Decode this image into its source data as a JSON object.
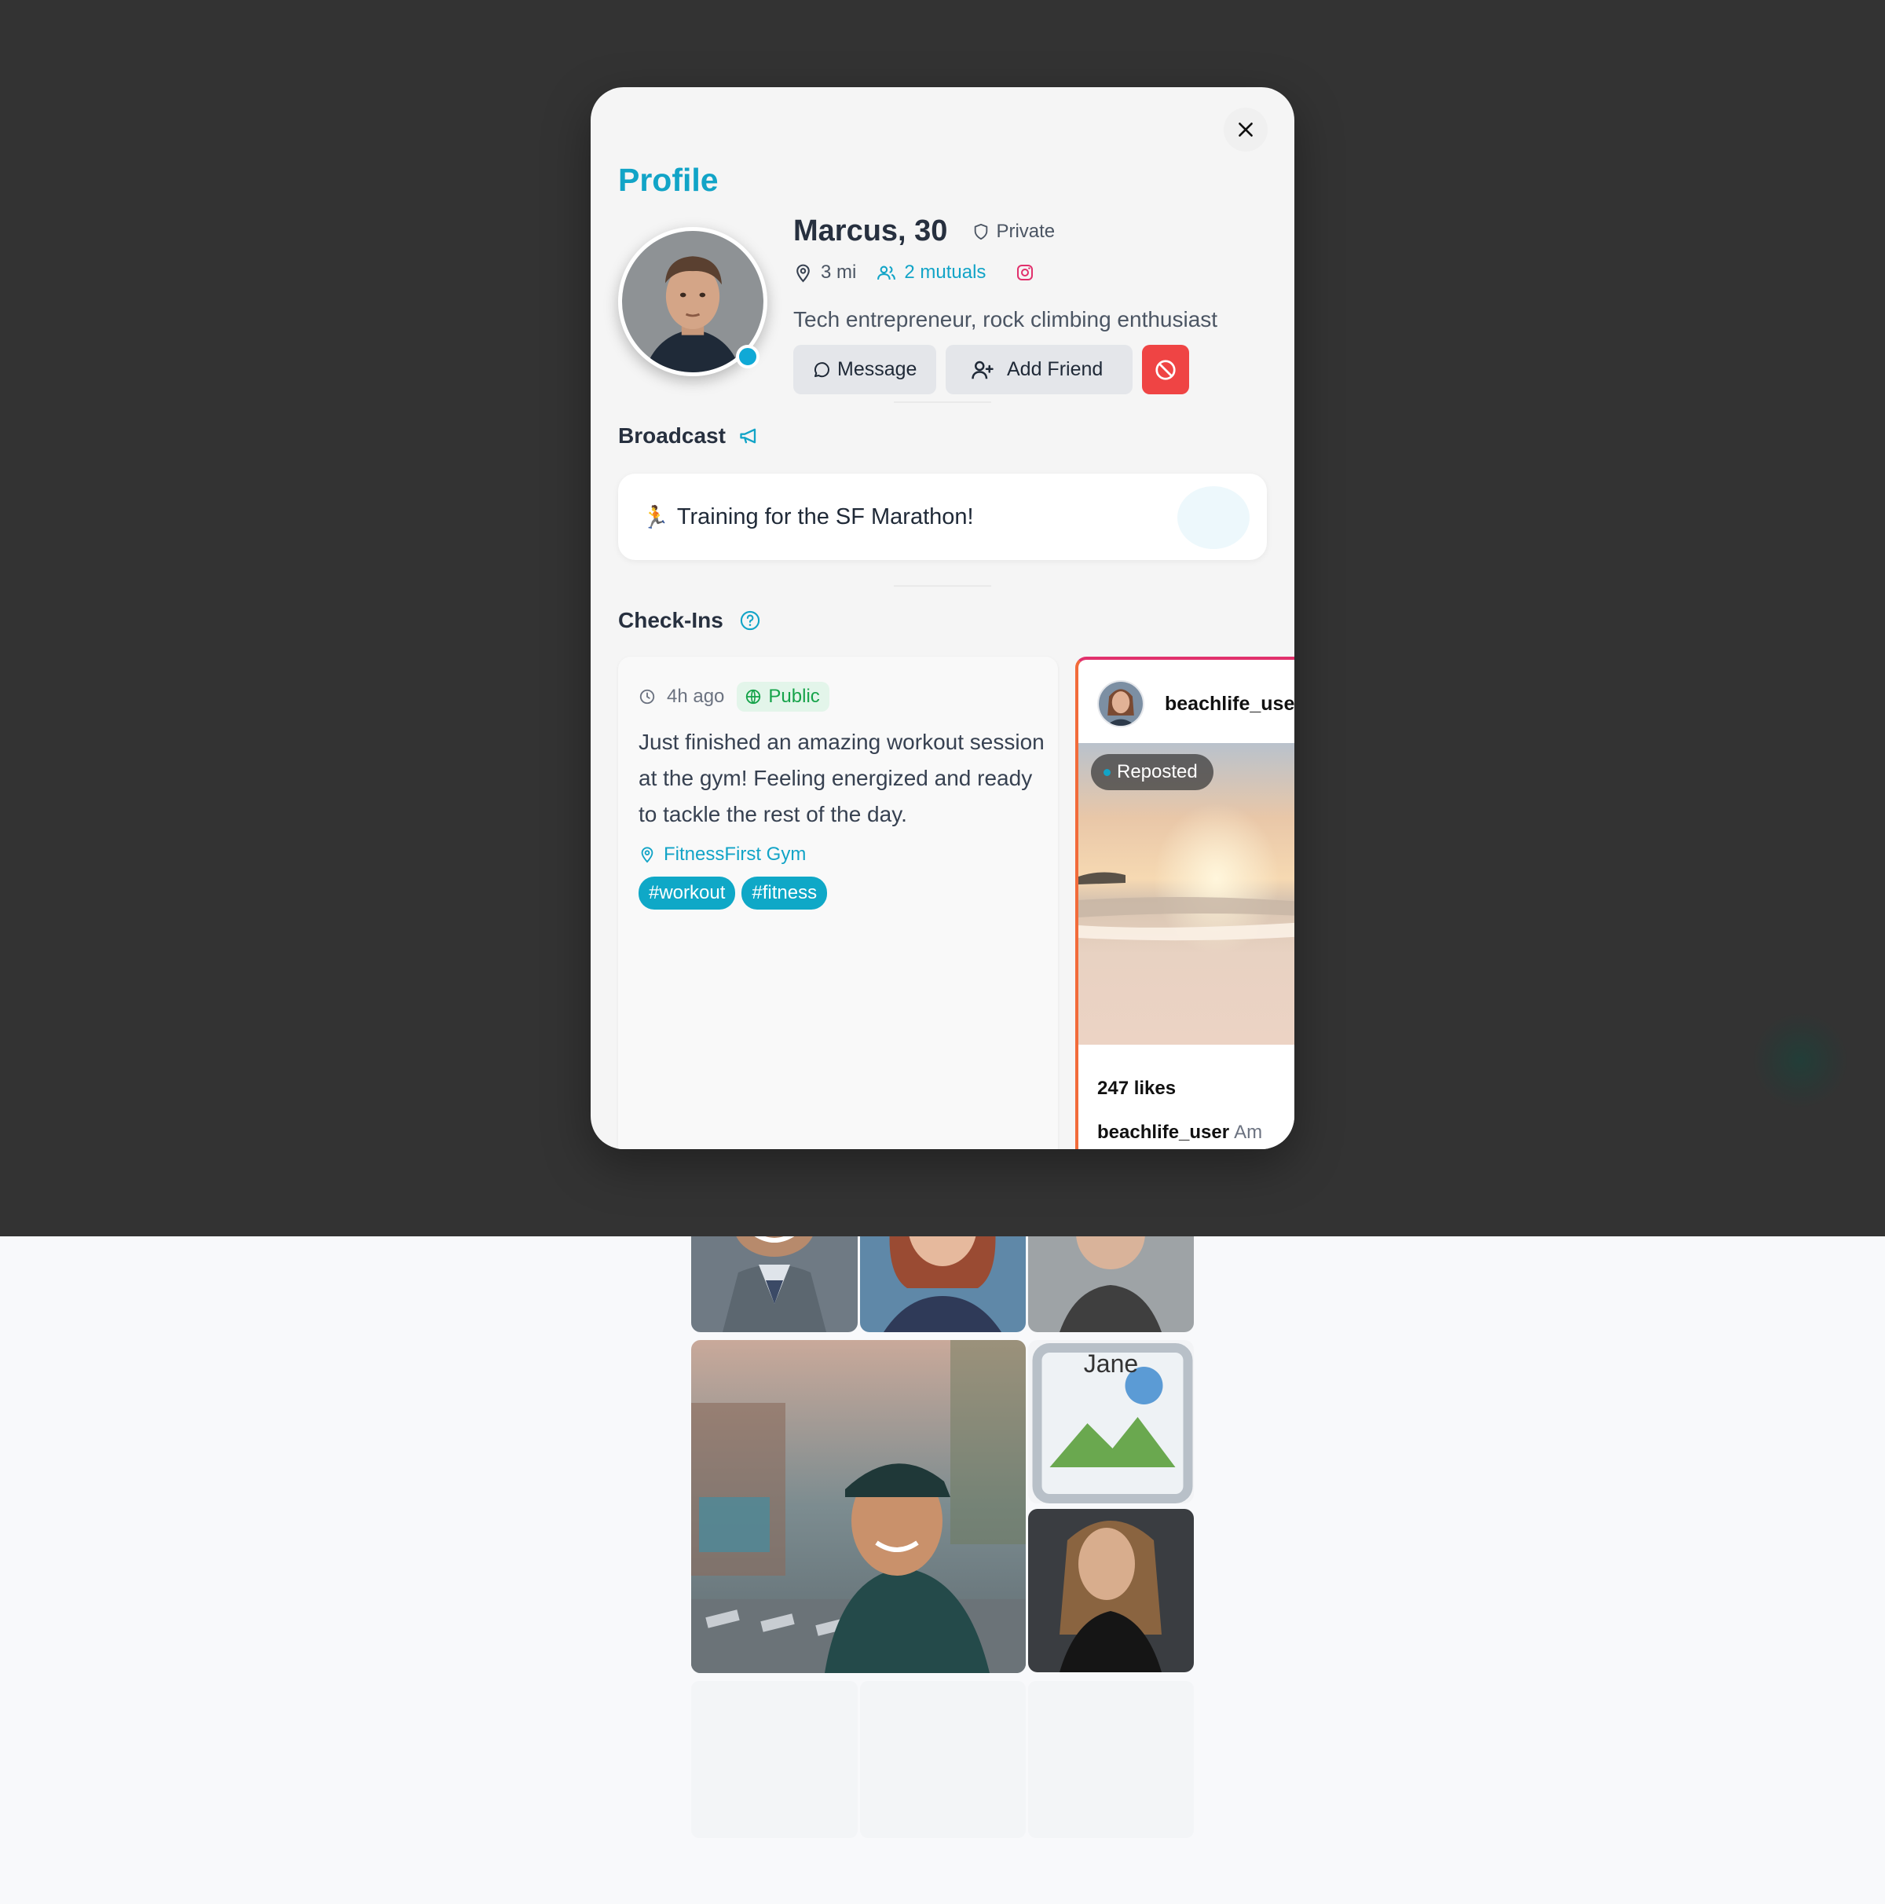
{
  "profile": {
    "heading": "Profile",
    "name_age": "Marcus, 30",
    "privacy_label": "Private",
    "distance": "3 mi",
    "mutuals": "2 mutuals",
    "bio": "Tech entrepreneur, rock climbing enthusiast",
    "online": true
  },
  "actions": {
    "message_label": "Message",
    "add_friend_label": "Add Friend",
    "block_icon": "block-icon"
  },
  "broadcast": {
    "heading": "Broadcast",
    "emoji": "🏃",
    "text": "Training for the SF Marathon!"
  },
  "checkins": {
    "heading": "Check-Ins",
    "items": [
      {
        "time": "4h ago",
        "visibility": "Public",
        "text": "Just finished an amazing workout session at the gym! Feeling energized and ready to tackle the rest of the day.",
        "location": "FitnessFirst Gym",
        "tags": [
          "#workout",
          "#fitness"
        ]
      }
    ],
    "instagram_post": {
      "username": "beachlife_user",
      "badge": "Reposted",
      "likes": "247 likes",
      "caption_user": "beachlife_user",
      "caption_text": "Am"
    }
  },
  "background_grid": {
    "broken_image_alt": "Jane"
  },
  "colors": {
    "accent": "#12a4c7",
    "danger": "#ef4444",
    "public_green": "#16a34a",
    "instagram_pink": "#e1306c",
    "overlay": "#333333"
  }
}
